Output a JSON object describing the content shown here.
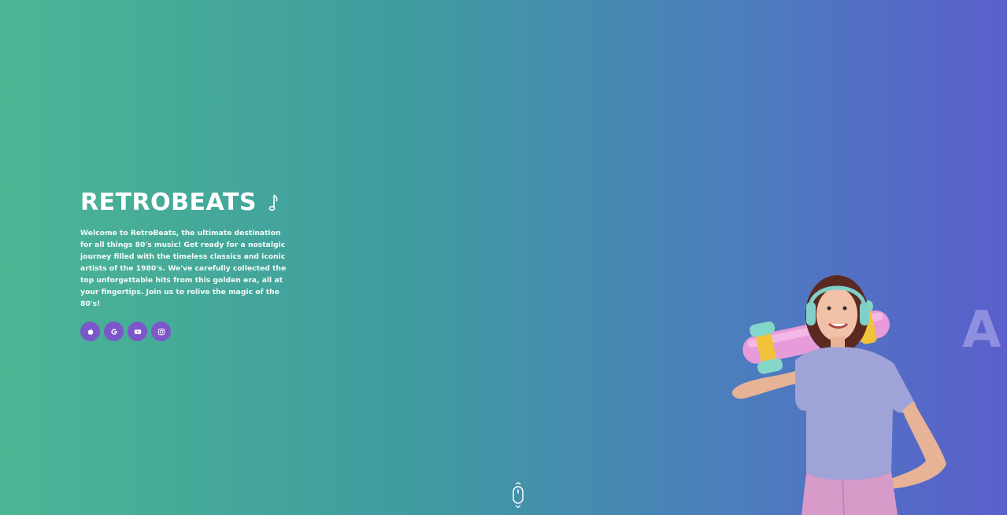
{
  "brand": {
    "title": "RETROBEATS",
    "title_icon": "music-note-icon"
  },
  "hero": {
    "description": "Welcome to RetroBeats, the ultimate destination for all things 80's music! Get ready for a nostalgic journey filled with the timeless classics and iconic artists of the 1980's. We've carefully collected the top unforgettable hits from this golden era, all at your fingertips. Join us to relive the magic of the 80's!",
    "side_letter": "A",
    "socials": [
      {
        "name": "apple-icon"
      },
      {
        "name": "google-icon"
      },
      {
        "name": "youtube-icon"
      },
      {
        "name": "instagram-icon"
      }
    ],
    "scroll_icon": "mouse-scroll-icon"
  },
  "colors": {
    "gradient_start": "#4bb694",
    "gradient_end": "#5a5fcc",
    "social_button": "#7b57c9",
    "text": "#ffffff"
  }
}
